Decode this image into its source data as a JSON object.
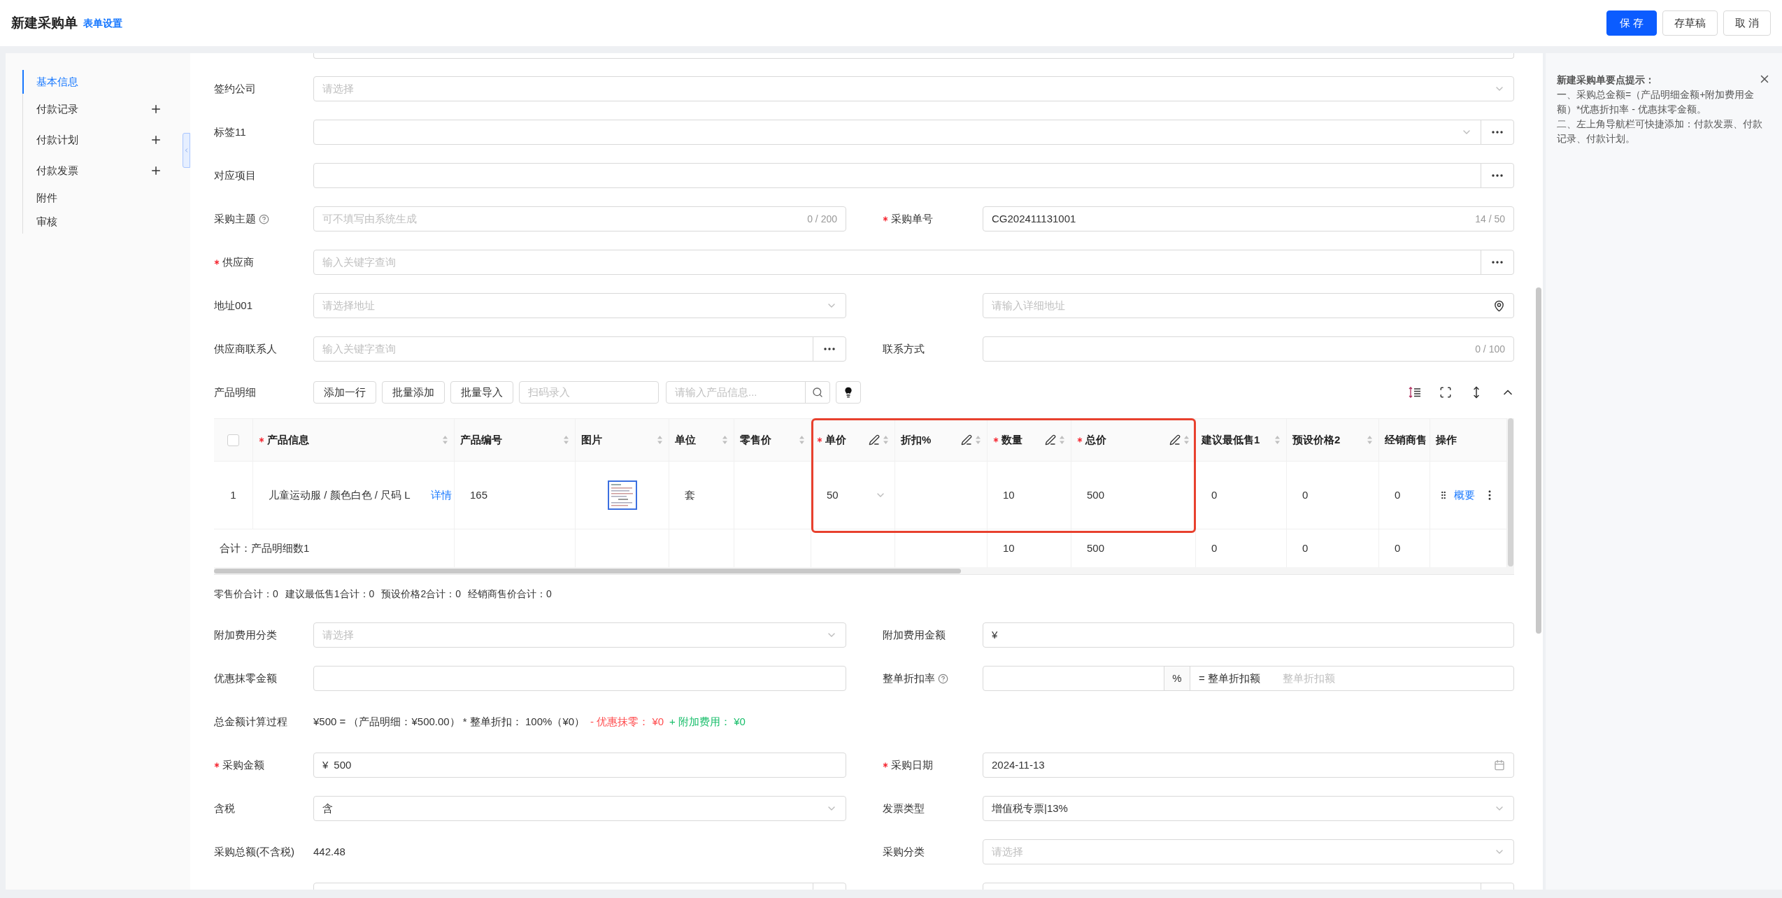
{
  "header": {
    "title": "新建采购单",
    "settings_link": "表单设置",
    "buttons": [
      {
        "label": "保 存",
        "kind": "primary"
      },
      {
        "label": "存草稿",
        "kind": "default"
      },
      {
        "label": "取 消",
        "kind": "default"
      }
    ]
  },
  "nav": {
    "items": [
      {
        "label": "基本信息",
        "selected": true
      },
      {
        "label": "付款记录",
        "selected": false,
        "addable": true
      },
      {
        "label": "付款计划",
        "selected": false,
        "addable": true
      },
      {
        "label": "付款发票",
        "selected": false,
        "addable": true
      },
      {
        "label": "附件",
        "selected": false
      },
      {
        "label": "审核",
        "selected": false
      }
    ]
  },
  "form_top": [
    {
      "fields": [
        {
          "label": "签约公司",
          "kind": "select",
          "placeholder": "请选择"
        }
      ]
    },
    {
      "fields": [
        {
          "label": "标签11",
          "kind": "select_more"
        }
      ]
    },
    {
      "fields": [
        {
          "label": "对应项目",
          "kind": "more"
        }
      ]
    },
    {
      "fields": [
        {
          "label": "采购主题",
          "help": true,
          "kind": "text",
          "placeholder": "可不填写由系统生成",
          "counter": "0 / 200"
        },
        {
          "label": "采购单号",
          "required": true,
          "kind": "text",
          "value": "CG202411131001",
          "counter": "14 / 50"
        }
      ]
    },
    {
      "fields": [
        {
          "label": "供应商",
          "required": true,
          "kind": "more",
          "placeholder": "输入关键字查询"
        }
      ]
    },
    {
      "fields": [
        {
          "label": "地址001",
          "kind": "select",
          "placeholder": "请选择地址"
        },
        {
          "kind": "address",
          "placeholder": "请输入详细地址"
        }
      ]
    },
    {
      "fields": [
        {
          "label": "供应商联系人",
          "kind": "more",
          "placeholder": "输入关键字查询"
        },
        {
          "label": "联系方式",
          "kind": "text",
          "counter": "0 / 100"
        }
      ]
    }
  ],
  "products": {
    "label": "产品明细",
    "buttons": [
      "添加一行",
      "批量添加",
      "批量导入"
    ],
    "scan_field": {
      "placeholder": "扫码录入"
    },
    "search_field": {
      "placeholder": "请输入产品信息..."
    },
    "table": {
      "columns": [
        {
          "kind": "checkbox",
          "checked": false
        },
        {
          "label": "产品信息",
          "required": true,
          "sortable": true
        },
        {
          "label": "产品编号",
          "sortable": true
        },
        {
          "label": "图片",
          "sortable": true
        },
        {
          "label": "单位",
          "sortable": true
        },
        {
          "label": "零售价",
          "sortable": true
        },
        {
          "label": "单价",
          "required": true,
          "editable": true,
          "sortable": true,
          "highlighted": true
        },
        {
          "label": "折扣%",
          "editable": true,
          "sortable": true,
          "highlighted": true
        },
        {
          "label": "数量",
          "required": true,
          "editable": true,
          "sortable": true,
          "highlighted": true
        },
        {
          "label": "总价",
          "required": true,
          "editable": true,
          "sortable": true,
          "highlighted": true
        },
        {
          "label": "建议最低售1",
          "sortable": true
        },
        {
          "label": "预设价格2",
          "sortable": true
        },
        {
          "label": "经销商售"
        },
        {
          "label": "操作"
        }
      ],
      "rows": [
        {
          "cells": [
            {
              "kind": "index",
              "text": "1"
            },
            {
              "kind": "product",
              "text": "儿童运动服 / 颜色白色 / 尺码 L",
              "link": "详情"
            },
            {
              "kind": "text",
              "text": "165"
            },
            {
              "kind": "picture"
            },
            {
              "kind": "text",
              "text": "套"
            },
            null,
            {
              "kind": "select",
              "text": "50"
            },
            null,
            {
              "kind": "text",
              "text": "10"
            },
            {
              "kind": "text",
              "text": "500"
            },
            {
              "kind": "text",
              "text": "0"
            },
            {
              "kind": "text",
              "text": "0"
            },
            {
              "kind": "text",
              "text": "0"
            },
            {
              "kind": "actions",
              "link": "概要"
            }
          ]
        }
      ],
      "total_row": {
        "label": "合计：产品明细数1",
        "cells": [
          null,
          null,
          null,
          null,
          null,
          null,
          "10",
          "500",
          "0",
          "0",
          "0",
          null
        ]
      }
    }
  },
  "summary": [
    "零售价合计：0",
    "建议最低售1合计：0",
    "预设价格2合计：0",
    "经销商售价合计：0"
  ],
  "form_bottom": [
    {
      "fields": [
        {
          "label": "附加费用分类",
          "kind": "select",
          "placeholder": "请选择"
        },
        {
          "label": "附加费用金额",
          "kind": "currency",
          "prefix": "¥"
        }
      ]
    },
    {
      "fields": [
        {
          "label": "优惠抹零金额",
          "kind": "text"
        },
        {
          "label": "整单折扣率",
          "help": true,
          "kind": "discount",
          "addon": "%",
          "result_label": "= 整单折扣额",
          "result_placeholder": "整单折扣额"
        }
      ]
    },
    {
      "fields": [
        {
          "label": "总金额计算过程",
          "kind": "formula",
          "segments": [
            {
              "text": "¥500 = （产品明细：¥500.00） * 整单折扣： 100%（¥0）",
              "color": "#333333"
            },
            {
              "text": "- 优惠抹零： ¥0",
              "color": "#ff4d4f"
            },
            {
              "text": "+ 附加费用： ¥0",
              "color": "#19be6b"
            }
          ]
        }
      ]
    },
    {
      "fields": [
        {
          "label": "采购金额",
          "required": true,
          "kind": "currency",
          "prefix": "¥",
          "value": "500"
        },
        {
          "label": "采购日期",
          "required": true,
          "kind": "date",
          "value": "2024-11-13"
        }
      ]
    },
    {
      "fields": [
        {
          "label": "含税",
          "kind": "select",
          "value": "含"
        },
        {
          "label": "发票类型",
          "kind": "select",
          "value": "增值税专票|13%"
        }
      ]
    },
    {
      "fields": [
        {
          "label": "采购总额(不含税)",
          "kind": "static",
          "value": "442.48"
        },
        {
          "label": "采购分类",
          "kind": "select",
          "placeholder": "请选择"
        }
      ]
    },
    {
      "fields": [
        {
          "kind": "more"
        },
        {
          "kind": "more"
        }
      ]
    }
  ],
  "hint": {
    "title": "新建采购单要点提示：",
    "paragraphs": [
      "一、采购总金额=（产品明细金额+附加费用金额）*优惠折扣率 - 优惠抹零金额。",
      "二、左上角导航栏可快捷添加：付款发票、付款记录、付款计划。"
    ]
  }
}
